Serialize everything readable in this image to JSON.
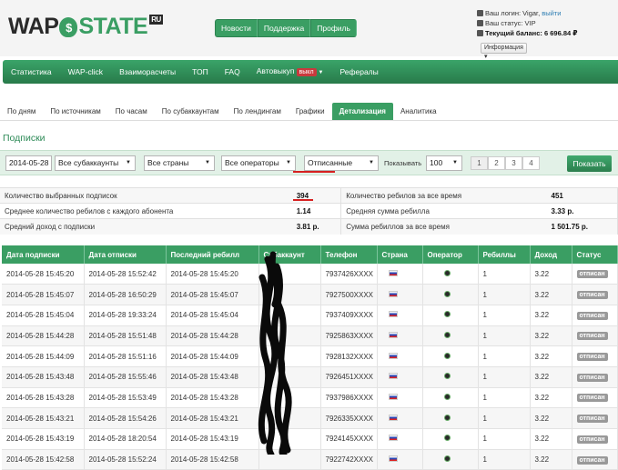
{
  "brand": {
    "logo_left": "WAP",
    "logo_coin": "$",
    "logo_right": "STATE",
    "logo_ru": "RU"
  },
  "top_nav": [
    "Новости",
    "Поддержка",
    "Профиль"
  ],
  "user": {
    "login_label": "Ваш логин:",
    "login": "Vigar,",
    "logout": "выйти",
    "status_label": "Ваш статус:",
    "status": "VIP",
    "balance_label": "Текущий баланс:",
    "balance": "6 696.84 ₽",
    "info_button": "Информация"
  },
  "main_nav": [
    "Статистика",
    "WAP-click",
    "Взаиморасчеты",
    "ТОП",
    "FAQ",
    "Автовыкуп",
    "Рефералы"
  ],
  "autobuy_badge": "выкл",
  "tabs": [
    "По дням",
    "По источникам",
    "По часам",
    "По субаккаунтам",
    "По лендингам",
    "Графики",
    "Детализация",
    "Аналитика"
  ],
  "active_tab": "Детализация",
  "section_title": "Подписки",
  "filters": {
    "date": "2014-05-28",
    "subaccounts": "Все субаккаунты",
    "countries": "Все страны",
    "operators": "Все операторы",
    "status": "Отписанные",
    "show_label": "Показывать",
    "per_page": "100",
    "pages": [
      "1",
      "2",
      "3",
      "4"
    ],
    "submit": "Показать"
  },
  "stats": [
    {
      "l1": "Количество выбранных подписок",
      "v1": "394",
      "l2": "Количество ребилов за все время",
      "v2": "451"
    },
    {
      "l1": "Среднее количество ребилов с каждого абонента",
      "v1": "1.14",
      "l2": "Средняя сумма ребилла",
      "v2": "3.33 р."
    },
    {
      "l1": "Средний доход с подписки",
      "v1": "3.81 р.",
      "l2": "Сумма ребиллов за все время",
      "v2": "1 501.75 р."
    }
  ],
  "columns": [
    "Дата подписки",
    "Дата отписки",
    "Последний ребилл",
    "Субаккаунт",
    "Телефон",
    "Страна",
    "Оператор",
    "Ребиллы",
    "Доход",
    "Статус"
  ],
  "rows": [
    [
      "2014-05-28 15:45:20",
      "2014-05-28 15:52:42",
      "2014-05-28 15:45:20",
      "7937426XXXX",
      "1",
      "3.22",
      "отписан"
    ],
    [
      "2014-05-28 15:45:07",
      "2014-05-28 16:50:29",
      "2014-05-28 15:45:07",
      "7927500XXXX",
      "1",
      "3.22",
      "отписан"
    ],
    [
      "2014-05-28 15:45:04",
      "2014-05-28 19:33:24",
      "2014-05-28 15:45:04",
      "7937409XXXX",
      "1",
      "3.22",
      "отписан"
    ],
    [
      "2014-05-28 15:44:28",
      "2014-05-28 15:51:48",
      "2014-05-28 15:44:28",
      "7925863XXXX",
      "1",
      "3.22",
      "отписан"
    ],
    [
      "2014-05-28 15:44:09",
      "2014-05-28 15:51:16",
      "2014-05-28 15:44:09",
      "7928132XXXX",
      "1",
      "3.22",
      "отписан"
    ],
    [
      "2014-05-28 15:43:48",
      "2014-05-28 15:55:46",
      "2014-05-28 15:43:48",
      "7926451XXXX",
      "1",
      "3.22",
      "отписан"
    ],
    [
      "2014-05-28 15:43:28",
      "2014-05-28 15:53:49",
      "2014-05-28 15:43:28",
      "7937986XXXX",
      "1",
      "3.22",
      "отписан"
    ],
    [
      "2014-05-28 15:43:21",
      "2014-05-28 15:54:26",
      "2014-05-28 15:43:21",
      "7926335XXXX",
      "1",
      "3.22",
      "отписан"
    ],
    [
      "2014-05-28 15:43:19",
      "2014-05-28 18:20:54",
      "2014-05-28 15:43:19",
      "7924145XXXX",
      "1",
      "3.22",
      "отписан"
    ],
    [
      "2014-05-28 15:42:58",
      "2014-05-28 15:52:24",
      "2014-05-28 15:42:58",
      "7922742XXXX",
      "1",
      "3.22",
      "отписан"
    ]
  ]
}
